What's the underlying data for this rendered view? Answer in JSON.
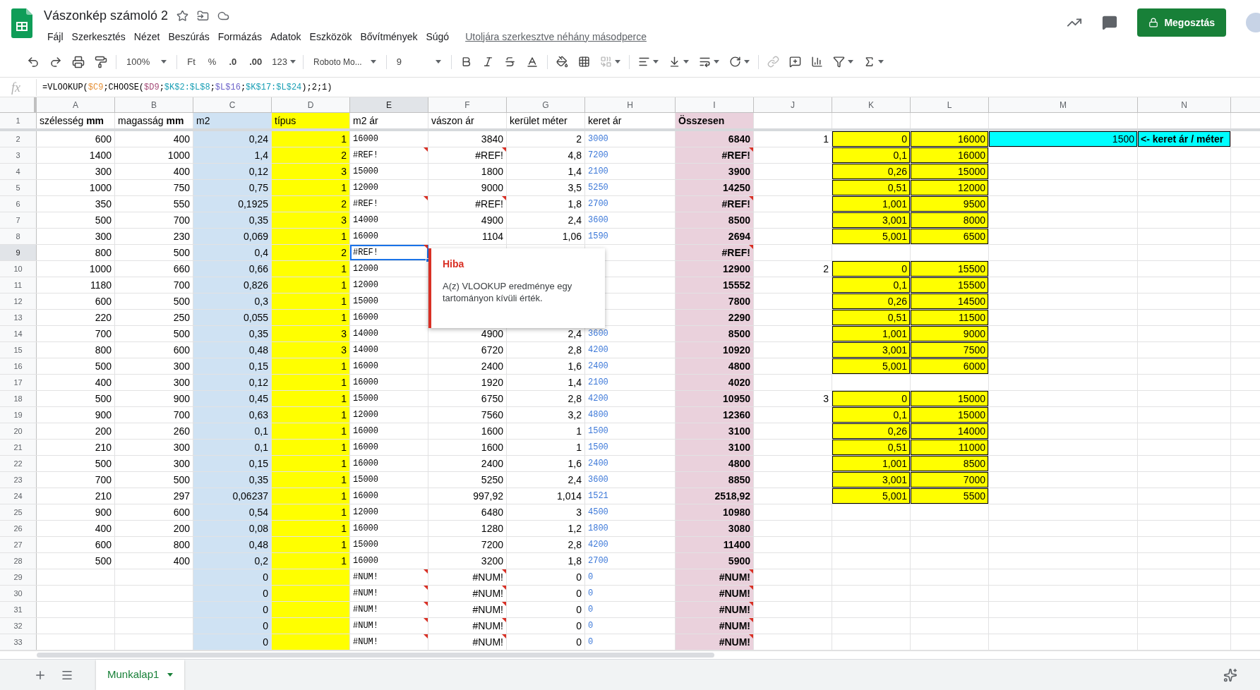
{
  "title": "Vászonkép számoló 2",
  "menu": [
    "Fájl",
    "Szerkesztés",
    "Nézet",
    "Beszúrás",
    "Formázás",
    "Adatok",
    "Eszközök",
    "Bővítmények",
    "Súgó"
  ],
  "last_edit": "Utoljára szerkesztve néhány másodperce",
  "share_button": "Megosztás",
  "toolbar": {
    "zoom": "100%",
    "currency": "Ft",
    "percent": "%",
    "decrease_decimals": ".0",
    "increase_decimals": ".00",
    "number_format": "123",
    "font": "Roboto Mo...",
    "font_size": "9"
  },
  "formula_label": "fx",
  "formula": [
    {
      "text": "=VLOOKUP(",
      "color": "#000000"
    },
    {
      "text": "$C9",
      "color": "#e69138"
    },
    {
      "text": ";CHOOSE(",
      "color": "#000000"
    },
    {
      "text": "$D9",
      "color": "#a64d79"
    },
    {
      "text": ";",
      "color": "#000000"
    },
    {
      "text": "$K$2:$L$8",
      "color": "#1a9fb5"
    },
    {
      "text": ";",
      "color": "#000000"
    },
    {
      "text": "$L$16",
      "color": "#6d64c9"
    },
    {
      "text": ";",
      "color": "#000000"
    },
    {
      "text": "$K$17:$L$24",
      "color": "#1a9fb5"
    },
    {
      "text": ");2;1)",
      "color": "#000000"
    }
  ],
  "columns": [
    {
      "letter": "A",
      "selected": false
    },
    {
      "letter": "B",
      "selected": false
    },
    {
      "letter": "C",
      "selected": false,
      "color": "#cfe2f3"
    },
    {
      "letter": "D",
      "selected": false,
      "color": "#ffff00"
    },
    {
      "letter": "E",
      "selected": true
    },
    {
      "letter": "F",
      "selected": false
    },
    {
      "letter": "G",
      "selected": false
    },
    {
      "letter": "H",
      "selected": false
    },
    {
      "letter": "I",
      "selected": false,
      "color": "#ead1dc"
    },
    {
      "letter": "J",
      "selected": false
    },
    {
      "letter": "K",
      "selected": false
    },
    {
      "letter": "L",
      "selected": false
    },
    {
      "letter": "M",
      "selected": false
    },
    {
      "letter": "N",
      "selected": false
    }
  ],
  "rows": [
    {
      "number": "1",
      "selected": false,
      "cells": [
        "szélesség **mm**",
        "magasság **mm**",
        "m2",
        "típus",
        "m2 ár",
        "vászon ár",
        "kerület méter",
        "keret ár",
        "Összesen"
      ]
    },
    {
      "number": "2",
      "selected": false,
      "cells": [
        "600",
        "400",
        "0,24",
        "1",
        "16000",
        "3840",
        "2",
        "3000",
        "6840",
        "1",
        {
          "text": "0",
          "color": "#ffff00"
        },
        {
          "text": "16000",
          "color": "#ffff00"
        },
        {
          "text": "1500",
          "color": "#00ffff"
        },
        {
          "text": "<- keret ár / méter",
          "color": "#00ffff"
        }
      ]
    },
    {
      "number": "3",
      "selected": false,
      "cells": [
        "1400",
        "1000",
        "1,4",
        "2",
        {
          "text": "#REF!",
          "error": true
        },
        {
          "text": "#REF!",
          "error": true
        },
        "4,8",
        "7200",
        {
          "text": "#REF!",
          "error": true
        },
        null,
        {
          "text": "0,1",
          "color": "#ffff00"
        },
        {
          "text": "16000",
          "color": "#ffff00"
        }
      ]
    },
    {
      "number": "4",
      "selected": false,
      "cells": [
        "300",
        "400",
        "0,12",
        "3",
        "15000",
        "1800",
        "1,4",
        "2100",
        "3900",
        null,
        {
          "text": "0,26",
          "color": "#ffff00"
        },
        {
          "text": "15000",
          "color": "#ffff00"
        }
      ]
    },
    {
      "number": "5",
      "selected": false,
      "cells": [
        "1000",
        "750",
        "0,75",
        "1",
        "12000",
        "9000",
        "3,5",
        "5250",
        "14250",
        null,
        {
          "text": "0,51",
          "color": "#ffff00"
        },
        {
          "text": "12000",
          "color": "#ffff00"
        }
      ]
    },
    {
      "number": "6",
      "selected": false,
      "cells": [
        "350",
        "550",
        "0,1925",
        "2",
        {
          "text": "#REF!",
          "error": true
        },
        {
          "text": "#REF!",
          "error": true
        },
        "1,8",
        "2700",
        {
          "text": "#REF!",
          "error": true
        },
        null,
        {
          "text": "1,001",
          "color": "#ffff00"
        },
        {
          "text": "9500",
          "color": "#ffff00"
        }
      ]
    },
    {
      "number": "7",
      "selected": false,
      "cells": [
        "500",
        "700",
        "0,35",
        "3",
        "14000",
        "4900",
        "2,4",
        "3600",
        "8500",
        null,
        {
          "text": "3,001",
          "color": "#ffff00"
        },
        {
          "text": "8000",
          "color": "#ffff00"
        }
      ]
    },
    {
      "number": "8",
      "selected": false,
      "cells": [
        "300",
        "230",
        "0,069",
        "1",
        "16000",
        "1104",
        "1,06",
        "1590",
        "2694",
        null,
        {
          "text": "5,001",
          "color": "#ffff00"
        },
        {
          "text": "6500",
          "color": "#ffff00"
        }
      ]
    },
    {
      "number": "9",
      "selected": true,
      "cells": [
        "800",
        "500",
        "0,4",
        "2",
        {
          "text": "#REF!",
          "error": true
        },
        null,
        null,
        null,
        {
          "text": "#REF!",
          "error": true
        }
      ]
    },
    {
      "number": "10",
      "selected": false,
      "cells": [
        "1000",
        "660",
        "0,66",
        "1",
        "12000",
        null,
        null,
        null,
        "12900",
        "2",
        {
          "text": "0",
          "color": "#ffff00"
        },
        {
          "text": "15500",
          "color": "#ffff00"
        }
      ]
    },
    {
      "number": "11",
      "selected": false,
      "cells": [
        "1180",
        "700",
        "0,826",
        "1",
        "12000",
        null,
        null,
        null,
        "15552",
        null,
        {
          "text": "0,1",
          "color": "#ffff00"
        },
        {
          "text": "15500",
          "color": "#ffff00"
        }
      ]
    },
    {
      "number": "12",
      "selected": false,
      "cells": [
        "600",
        "500",
        "0,3",
        "1",
        "15000",
        null,
        null,
        null,
        "7800",
        null,
        {
          "text": "0,26",
          "color": "#ffff00"
        },
        {
          "text": "14500",
          "color": "#ffff00"
        }
      ]
    },
    {
      "number": "13",
      "selected": false,
      "cells": [
        "220",
        "250",
        "0,055",
        "1",
        "16000",
        null,
        null,
        null,
        "2290",
        null,
        {
          "text": "0,51",
          "color": "#ffff00"
        },
        {
          "text": "11500",
          "color": "#ffff00"
        }
      ]
    },
    {
      "number": "14",
      "selected": false,
      "cells": [
        "700",
        "500",
        "0,35",
        "3",
        "14000",
        "4900",
        "2,4",
        "3600",
        "8500",
        null,
        {
          "text": "1,001",
          "color": "#ffff00"
        },
        {
          "text": "9000",
          "color": "#ffff00"
        }
      ]
    },
    {
      "number": "15",
      "selected": false,
      "cells": [
        "800",
        "600",
        "0,48",
        "3",
        "14000",
        "6720",
        "2,8",
        "4200",
        "10920",
        null,
        {
          "text": "3,001",
          "color": "#ffff00"
        },
        {
          "text": "7500",
          "color": "#ffff00"
        }
      ]
    },
    {
      "number": "16",
      "selected": false,
      "cells": [
        "500",
        "300",
        "0,15",
        "1",
        "16000",
        "2400",
        "1,6",
        "2400",
        "4800",
        null,
        {
          "text": "5,001",
          "color": "#ffff00"
        },
        {
          "text": "6000",
          "color": "#ffff00"
        }
      ]
    },
    {
      "number": "17",
      "selected": false,
      "cells": [
        "400",
        "300",
        "0,12",
        "1",
        "16000",
        "1920",
        "1,4",
        "2100",
        "4020"
      ]
    },
    {
      "number": "18",
      "selected": false,
      "cells": [
        "500",
        "900",
        "0,45",
        "1",
        "15000",
        "6750",
        "2,8",
        "4200",
        "10950",
        "3",
        {
          "text": "0",
          "color": "#ffff00"
        },
        {
          "text": "15000",
          "color": "#ffff00"
        }
      ]
    },
    {
      "number": "19",
      "selected": false,
      "cells": [
        "900",
        "700",
        "0,63",
        "1",
        "12000",
        "7560",
        "3,2",
        "4800",
        "12360",
        null,
        {
          "text": "0,1",
          "color": "#ffff00"
        },
        {
          "text": "15000",
          "color": "#ffff00"
        }
      ]
    },
    {
      "number": "20",
      "selected": false,
      "cells": [
        "200",
        "260",
        "0,1",
        "1",
        "16000",
        "1600",
        "1",
        "1500",
        "3100",
        null,
        {
          "text": "0,26",
          "color": "#ffff00"
        },
        {
          "text": "14000",
          "color": "#ffff00"
        }
      ]
    },
    {
      "number": "21",
      "selected": false,
      "cells": [
        "210",
        "300",
        "0,1",
        "1",
        "16000",
        "1600",
        "1",
        "1500",
        "3100",
        null,
        {
          "text": "0,51",
          "color": "#ffff00"
        },
        {
          "text": "11000",
          "color": "#ffff00"
        }
      ]
    },
    {
      "number": "22",
      "selected": false,
      "cells": [
        "500",
        "300",
        "0,15",
        "1",
        "16000",
        "2400",
        "1,6",
        "2400",
        "4800",
        null,
        {
          "text": "1,001",
          "color": "#ffff00"
        },
        {
          "text": "8500",
          "color": "#ffff00"
        }
      ]
    },
    {
      "number": "23",
      "selected": false,
      "cells": [
        "700",
        "500",
        "0,35",
        "1",
        "15000",
        "5250",
        "2,4",
        "3600",
        "8850",
        null,
        {
          "text": "3,001",
          "color": "#ffff00"
        },
        {
          "text": "7000",
          "color": "#ffff00"
        }
      ]
    },
    {
      "number": "24",
      "selected": false,
      "cells": [
        "210",
        "297",
        "0,06237",
        "1",
        "16000",
        "997,92",
        "1,014",
        "1521",
        "2518,92",
        null,
        {
          "text": "5,001",
          "color": "#ffff00"
        },
        {
          "text": "5500",
          "color": "#ffff00"
        }
      ]
    },
    {
      "number": "25",
      "selected": false,
      "cells": [
        "900",
        "600",
        "0,54",
        "1",
        "12000",
        "6480",
        "3",
        "4500",
        "10980"
      ]
    },
    {
      "number": "26",
      "selected": false,
      "cells": [
        "400",
        "200",
        "0,08",
        "1",
        "16000",
        "1280",
        "1,2",
        "1800",
        "3080"
      ]
    },
    {
      "number": "27",
      "selected": false,
      "cells": [
        "600",
        "800",
        "0,48",
        "1",
        "15000",
        "7200",
        "2,8",
        "4200",
        "11400"
      ]
    },
    {
      "number": "28",
      "selected": false,
      "cells": [
        "500",
        "400",
        "0,2",
        "1",
        "16000",
        "3200",
        "1,8",
        "2700",
        "5900"
      ]
    },
    {
      "number": "29",
      "selected": false,
      "cells": [
        null,
        null,
        "0",
        null,
        {
          "text": "#NUM!",
          "error": true
        },
        {
          "text": "#NUM!",
          "error": true
        },
        "0",
        "0",
        {
          "text": "#NUM!",
          "error": true
        }
      ]
    },
    {
      "number": "30",
      "selected": false,
      "cells": [
        null,
        null,
        "0",
        null,
        {
          "text": "#NUM!",
          "error": true
        },
        {
          "text": "#NUM!",
          "error": true
        },
        "0",
        "0",
        {
          "text": "#NUM!",
          "error": true
        }
      ]
    },
    {
      "number": "31",
      "selected": false,
      "cells": [
        null,
        null,
        "0",
        null,
        {
          "text": "#NUM!",
          "error": true
        },
        {
          "text": "#NUM!",
          "error": true
        },
        "0",
        "0",
        {
          "text": "#NUM!",
          "error": true
        }
      ]
    },
    {
      "number": "32",
      "selected": false,
      "cells": [
        null,
        null,
        "0",
        null,
        {
          "text": "#NUM!",
          "error": true
        },
        {
          "text": "#NUM!",
          "error": true
        },
        "0",
        "0",
        {
          "text": "#NUM!",
          "error": true
        }
      ]
    },
    {
      "number": "33",
      "selected": false,
      "cells": [
        null,
        null,
        "0",
        null,
        {
          "text": "#NUM!",
          "error": true
        },
        {
          "text": "#NUM!",
          "error": true
        },
        "0",
        "0",
        {
          "text": "#NUM!",
          "error": true
        }
      ]
    }
  ],
  "tooltip": {
    "title": "Hiba",
    "message": "A(z) VLOOKUP eredménye egy tartományon kívüli érték."
  },
  "sheets": [
    {
      "name": "Munkalap1",
      "selected": true
    }
  ]
}
